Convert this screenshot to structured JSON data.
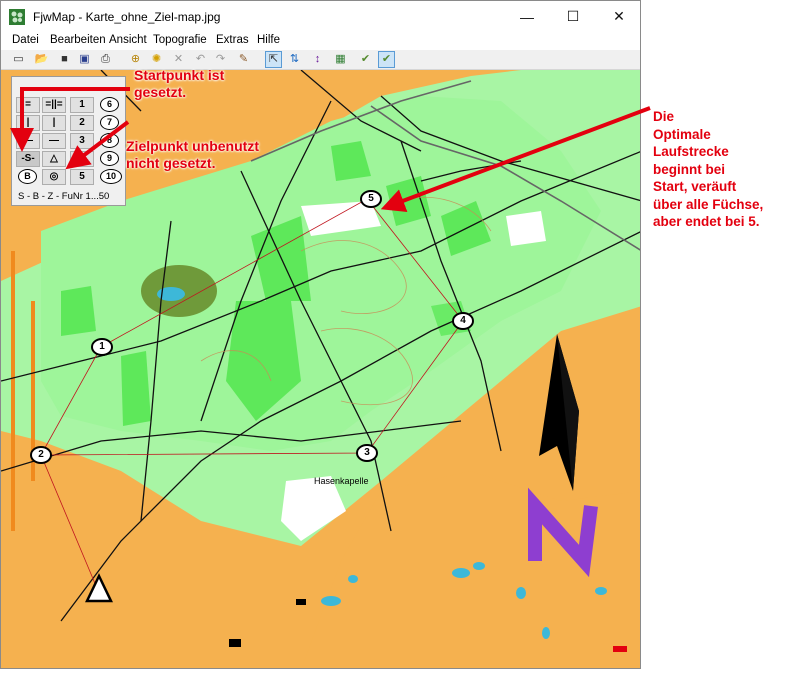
{
  "window": {
    "title": "FjwMap - Karte_ohne_Ziel-map.jpg",
    "minimize": "—",
    "maximize": "☐",
    "close": "✕"
  },
  "menu": [
    "Datei",
    "Bearbeiten",
    "Ansicht",
    "Topografie",
    "Extras",
    "Hilfe"
  ],
  "toolbar_icons": [
    "new-icon",
    "open-icon",
    "folder-red-icon",
    "save-icon",
    "print-icon",
    "add-control-icon",
    "sun-icon",
    "delete-icon",
    "undo-icon",
    "redo-icon",
    "ruler-icon",
    "select-icon",
    "sort-numbers-icon",
    "sort-up-icon",
    "grid-icon",
    "edit-route-icon",
    "check-route-icon"
  ],
  "fox_panel": {
    "rows": [
      [
        "=",
        "=||=",
        "1"
      ],
      [
        "|",
        "|",
        "2"
      ],
      [
        "—",
        "—",
        "3"
      ],
      [
        "-S-",
        "△",
        "4"
      ],
      [
        "B",
        "◎",
        "5"
      ]
    ],
    "circles": [
      "6",
      "7",
      "8",
      "9",
      "10"
    ],
    "footer": "S - B - Z - FuNr 1...50"
  },
  "annotations": {
    "start": [
      "Startpunkt ist",
      "gesetzt."
    ],
    "goal": [
      "Zielpunkt unbenutzt",
      "nicht gesetzt."
    ],
    "route": [
      "Die",
      "Optimale",
      "Laufstrecke",
      "beginnt bei",
      "Start, veräuft",
      "über alle Füchse,",
      "aber endet bei 5."
    ]
  },
  "map": {
    "place_label": "Hasenkapelle",
    "controls": [
      {
        "label": "1"
      },
      {
        "label": "2"
      },
      {
        "label": "3"
      },
      {
        "label": "4"
      },
      {
        "label": "5"
      }
    ],
    "north_letter": "N",
    "colors": {
      "forest_light": "#9ef59a",
      "forest_green": "#5ee85a",
      "open_land": "#f5b14f",
      "route": "#c0151f",
      "annotation": "#e3000f",
      "north": "#8e3ed0"
    }
  }
}
